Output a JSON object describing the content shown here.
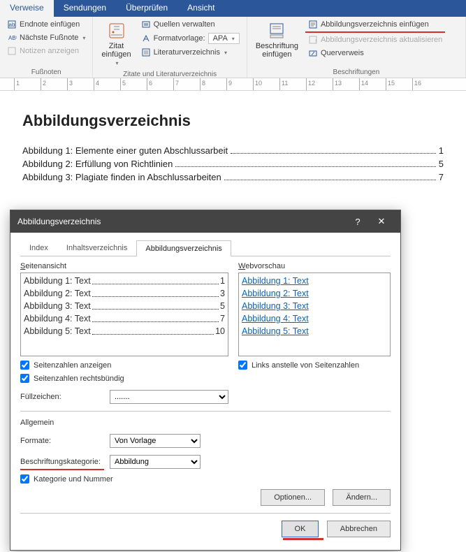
{
  "ribbon_tabs": {
    "active": "Verweise",
    "items": [
      "Verweise",
      "Sendungen",
      "Überprüfen",
      "Ansicht"
    ]
  },
  "ribbon": {
    "fussnoten": {
      "endnote": "Endnote einfügen",
      "naechste": "Nächste Fußnote",
      "notizen": "Notizen anzeigen",
      "group": "Fußnoten"
    },
    "zitate": {
      "big": "Zitat\neinfügen",
      "quellen": "Quellen verwalten",
      "formatvorlage": "Formatvorlage:",
      "apa": "APA",
      "lit": "Literaturverzeichnis",
      "group": "Zitate und Literaturverzeichnis"
    },
    "beschriftung": {
      "big": "Beschriftung\neinfügen",
      "einfuegen": "Abbildungsverzeichnis einfügen",
      "aktualisieren": "Abbildungsverzeichnis aktualisieren",
      "querverweis": "Querverweis",
      "group": "Beschriftungen"
    }
  },
  "document": {
    "title": "Abbildungsverzeichnis",
    "entries": [
      {
        "text": "Abbildung 1: Elemente einer guten Abschlussarbeit",
        "page": "1"
      },
      {
        "text": "Abbildung 2: Erfüllung von Richtlinien",
        "page": "5"
      },
      {
        "text": "Abbildung 3: Plagiate finden in Abschlussarbeiten",
        "page": "7"
      }
    ]
  },
  "dialog": {
    "title": "Abbildungsverzeichnis",
    "tabs": [
      "Index",
      "Inhaltsverzeichnis",
      "Abbildungsverzeichnis"
    ],
    "active_tab": 2,
    "seitenansicht": "Seitenansicht",
    "webvorschau": "Webvorschau",
    "preview_rows": [
      {
        "t": "Abbildung 1: Text",
        "p": "1"
      },
      {
        "t": "Abbildung 2: Text",
        "p": "3"
      },
      {
        "t": "Abbildung 3: Text",
        "p": "5"
      },
      {
        "t": "Abbildung 4: Text",
        "p": "7"
      },
      {
        "t": "Abbildung 5: Text",
        "p": "10"
      }
    ],
    "web_rows": [
      "Abbildung 1: Text",
      "Abbildung 2: Text",
      "Abbildung 3: Text",
      "Abbildung 4: Text",
      "Abbildung 5: Text"
    ],
    "chk_seiten": "Seitenzahlen anzeigen",
    "chk_rechts": "Seitenzahlen rechtsbündig",
    "chk_links": "Links anstelle von Seitenzahlen",
    "fuellzeichen": "Füllzeichen:",
    "fuell_val": ".......",
    "allgemein": "Allgemein",
    "formate": "Formate:",
    "formate_val": "Von Vorlage",
    "kategorie": "Beschriftungskategorie:",
    "kategorie_val": "Abbildung",
    "chk_kat": "Kategorie und Nummer",
    "btn_optionen": "Optionen...",
    "btn_aendern": "Ändern...",
    "btn_ok": "OK",
    "btn_abbrechen": "Abbrechen"
  }
}
